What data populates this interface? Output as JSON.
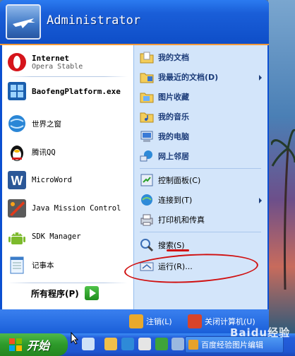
{
  "user": {
    "name": "Administrator"
  },
  "pinned": [
    {
      "title": "Internet",
      "subtitle": "Opera Stable",
      "icon": "opera-icon"
    }
  ],
  "recent_programs": [
    {
      "label": "BaofengPlatform.exe",
      "icon": "baofeng-icon"
    },
    {
      "label": "世界之窗",
      "icon": "browser-globe-icon"
    },
    {
      "label": "腾讯QQ",
      "icon": "qq-penguin-icon"
    },
    {
      "label": "MicroWord",
      "icon": "word-icon"
    },
    {
      "label": "Java Mission Control",
      "icon": "java-mission-control-icon"
    },
    {
      "label": "SDK Manager",
      "icon": "android-icon"
    },
    {
      "label": "记事本",
      "icon": "notepad-icon"
    }
  ],
  "all_programs": {
    "label": "所有程序(P)"
  },
  "right_items": [
    {
      "label": "我的文档",
      "icon": "documents-folder-icon",
      "submenu": false
    },
    {
      "label": "我最近的文档(D)",
      "icon": "recent-documents-icon",
      "submenu": true
    },
    {
      "label": "图片收藏",
      "icon": "pictures-folder-icon",
      "submenu": false
    },
    {
      "label": "我的音乐",
      "icon": "music-folder-icon",
      "submenu": false
    },
    {
      "label": "我的电脑",
      "icon": "computer-icon",
      "submenu": false
    },
    {
      "label": "网上邻居",
      "icon": "network-icon",
      "submenu": false
    },
    {
      "label": "控制面板(C)",
      "icon": "control-panel-icon",
      "submenu": false
    },
    {
      "label": "连接到(T)",
      "icon": "connect-icon",
      "submenu": true
    },
    {
      "label": "打印机和传真",
      "icon": "printer-icon",
      "submenu": false
    },
    {
      "label": "搜索(S)",
      "icon": "search-icon",
      "submenu": false
    },
    {
      "label": "运行(R)...",
      "icon": "run-icon",
      "submenu": false
    }
  ],
  "footer": {
    "logoff": "注销(L)",
    "shutdown": "关闭计算机(U)"
  },
  "taskbar": {
    "start_label": "开始",
    "window_button": "百度经验图片编辑",
    "watermark": "Baidu经验"
  },
  "colors": {
    "start_menu_blue": "#0b4fd1",
    "right_pane": "#d3e5fa",
    "header_accent": "#f29a3a",
    "annotation_red": "#d01010"
  }
}
